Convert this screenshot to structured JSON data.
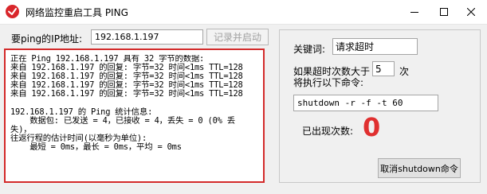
{
  "window": {
    "title": "网络监控重启工具 PING"
  },
  "ip": {
    "label": "要ping的IP地址:",
    "value": "192.168.1.197"
  },
  "record_button": "记录并启动",
  "log": {
    "text": "正在 Ping 192.168.1.197 具有 32 字节的数据:\n来自 192.168.1.197 的回复: 字节=32 时间<1ms TTL=128\n来自 192.168.1.197 的回复: 字节=32 时间<1ms TTL=128\n来自 192.168.1.197 的回复: 字节=32 时间<1ms TTL=128\n来自 192.168.1.197 的回复: 字节=32 时间<1ms TTL=128\n\n192.168.1.197 的 Ping 统计信息:\n    数据包: 已发送 = 4，已接收 = 4，丢失 = 0 (0% 丢\n失)，\n往返行程的估计时间(以毫秒为单位):\n    最短 = 0ms，最长 = 0ms，平均 = 0ms"
  },
  "keyword": {
    "label": "关键词:",
    "value": "请求超时"
  },
  "timeout": {
    "label_line1": "如果超时次数大于",
    "value": "5",
    "unit": "次",
    "label_line2": "将执行以下命令:"
  },
  "command": {
    "value": "shutdown -r -f -t 60"
  },
  "occurrence": {
    "label": "已出现次数:",
    "value": "0"
  },
  "cancel_button": "取消shutdown命令",
  "colors": {
    "accent_red": "#d32a2a",
    "count_red": "#e03030"
  }
}
